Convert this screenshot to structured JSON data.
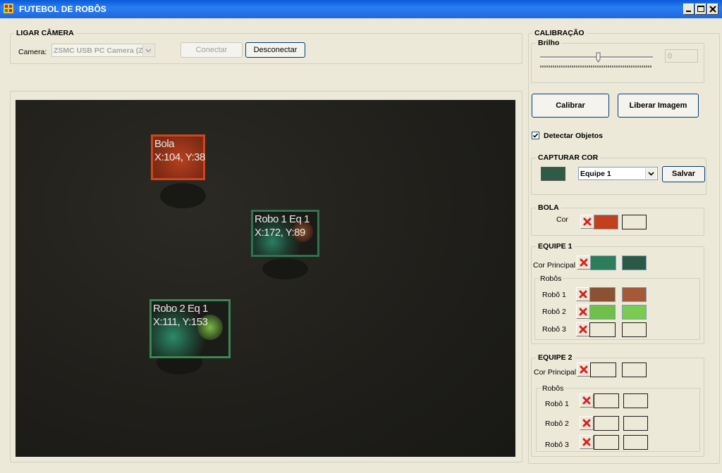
{
  "window": {
    "title": "FUTEBOL DE ROBÔS"
  },
  "camera_group": {
    "title": "LIGAR CÂMERA",
    "camera_label": "Camera:",
    "camera_value": "ZSMC USB PC Camera (Z",
    "connect_label": "Conectar",
    "disconnect_label": "Desconectar"
  },
  "detections": [
    {
      "line1": "Bola",
      "line2": "X:104, Y:38",
      "color": "#d7401a"
    },
    {
      "line1": "Robo 1 Eq 1",
      "line2": "X:172, Y:89",
      "color": "#2e7a55"
    },
    {
      "line1": "Robo 2 Eq 1",
      "line2": "X:111, Y:153",
      "color": "#3e8a5e"
    }
  ],
  "calibration": {
    "title": "CALIBRAÇÃO",
    "brightness_label": "Brilho",
    "brightness_value": "0",
    "calibrate_label": "Calibrar",
    "release_label": "Liberar Imagem",
    "detect_label": "Detectar Objetos",
    "detect_checked": true
  },
  "capture": {
    "title": "CAPTURAR COR",
    "swatch_color": "#2f5a45",
    "team_value": "Equipe 1",
    "save_label": "Salvar"
  },
  "ball": {
    "title": "BOLA",
    "color_label": "Cor",
    "color": "#c2401c"
  },
  "team1": {
    "title": "EQUIPE 1",
    "main_label": "Cor Principal",
    "main_color_a": "#2d7d5a",
    "main_color_b": "#2a5945",
    "robots_title": "Robôs",
    "robots": [
      {
        "label": "Robô 1",
        "color_a": "#8a5230",
        "color_b": "#a45a38"
      },
      {
        "label": "Robô 2",
        "color_a": "#6fbf4a",
        "color_b": "#7acb52"
      },
      {
        "label": "Robô 3",
        "color_a": "",
        "color_b": ""
      }
    ]
  },
  "team2": {
    "title": "EQUIPE 2",
    "main_label": "Cor Principal",
    "robots_title": "Robôs",
    "robots": [
      {
        "label": "Robô 1"
      },
      {
        "label": "Robô 2"
      },
      {
        "label": "Robô 3"
      }
    ]
  }
}
